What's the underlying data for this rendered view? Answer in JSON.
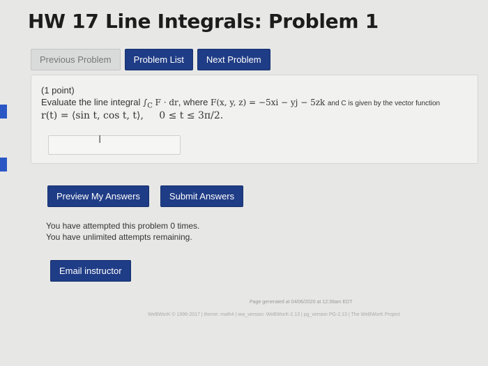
{
  "page": {
    "title": "HW 17 Line Integrals: Problem 1"
  },
  "nav": {
    "previous": "Previous Problem",
    "list": "Problem List",
    "next": "Next Problem"
  },
  "problem": {
    "points": "(1 point)",
    "text_prefix": "Evaluate the line integral",
    "integral_expr": "∫",
    "integral_sub": "C",
    "integral_body": "F · dr",
    "text_where": ", where",
    "field_expr": "F(x, y, z) = −5xi − yj − 5zk",
    "text_suffix": "and C is given by the vector function",
    "curve_expr": "r(t) = ⟨sin t, cos t, t⟩,",
    "interval_expr": "0 ≤ t ≤ 3π/2.",
    "answer_value": "",
    "cursor_glyph": "I"
  },
  "actions": {
    "preview": "Preview My Answers",
    "submit": "Submit Answers",
    "email": "Email instructor"
  },
  "status": {
    "attempted": "You have attempted this problem 0 times.",
    "remaining": "You have unlimited attempts remaining."
  },
  "footer": {
    "generated": "Page generated at 04/06/2020 at 12:39am EDT",
    "version": "WeBWorK © 1996-2017 | theme: math4 | ww_version: WeBWorK-2.13 | pg_version PG-2.13 | The WeBWorK Project"
  },
  "colors": {
    "primary": "#1f3c86",
    "accent": "#2a57c4"
  }
}
